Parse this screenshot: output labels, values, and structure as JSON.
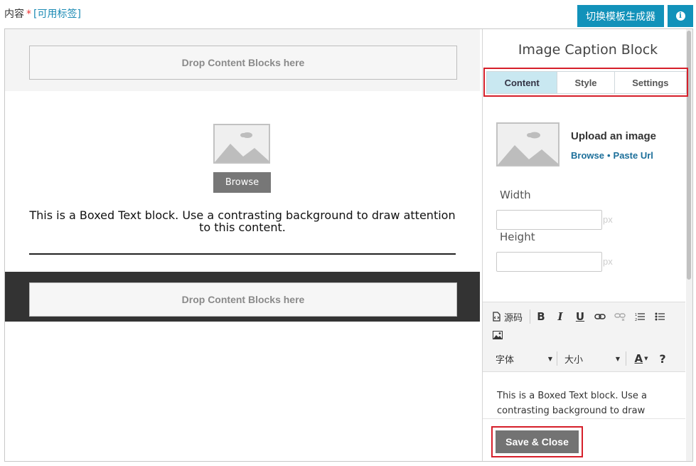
{
  "header": {
    "content_label": "内容",
    "required_mark": "*",
    "tags_link": "[可用标签]",
    "switch_button": "切换模板生成器"
  },
  "canvas": {
    "drop_top": "Drop Content Blocks here",
    "browse_label": "Browse",
    "boxed_text": "This is a Boxed Text block. Use a contrasting background to draw attention to this content.",
    "drop_bottom": "Drop Content Blocks here"
  },
  "panel": {
    "title": "Image Caption Block",
    "tabs": [
      {
        "label": "Content",
        "active": true
      },
      {
        "label": "Style",
        "active": false
      },
      {
        "label": "Settings",
        "active": false
      }
    ],
    "upload_title": "Upload an image",
    "browse_link": "Browse",
    "link_separator": "•",
    "paste_url_link": "Paste Url",
    "width_label": "Width",
    "height_label": "Height",
    "unit": "px"
  },
  "editor": {
    "source_label": "源码",
    "bold": "B",
    "italic": "I",
    "underline": "U",
    "font_label": "字体",
    "size_label": "大小",
    "font_color": "A",
    "help": "?",
    "content_text": "This is a Boxed Text block. Use a contrasting background to draw"
  },
  "footer": {
    "save_label": "Save & Close"
  },
  "colors": {
    "accent": "#1292ba",
    "highlight": "#d61f2a",
    "active_tab": "#c9e8f1",
    "dark_band": "#333333"
  }
}
